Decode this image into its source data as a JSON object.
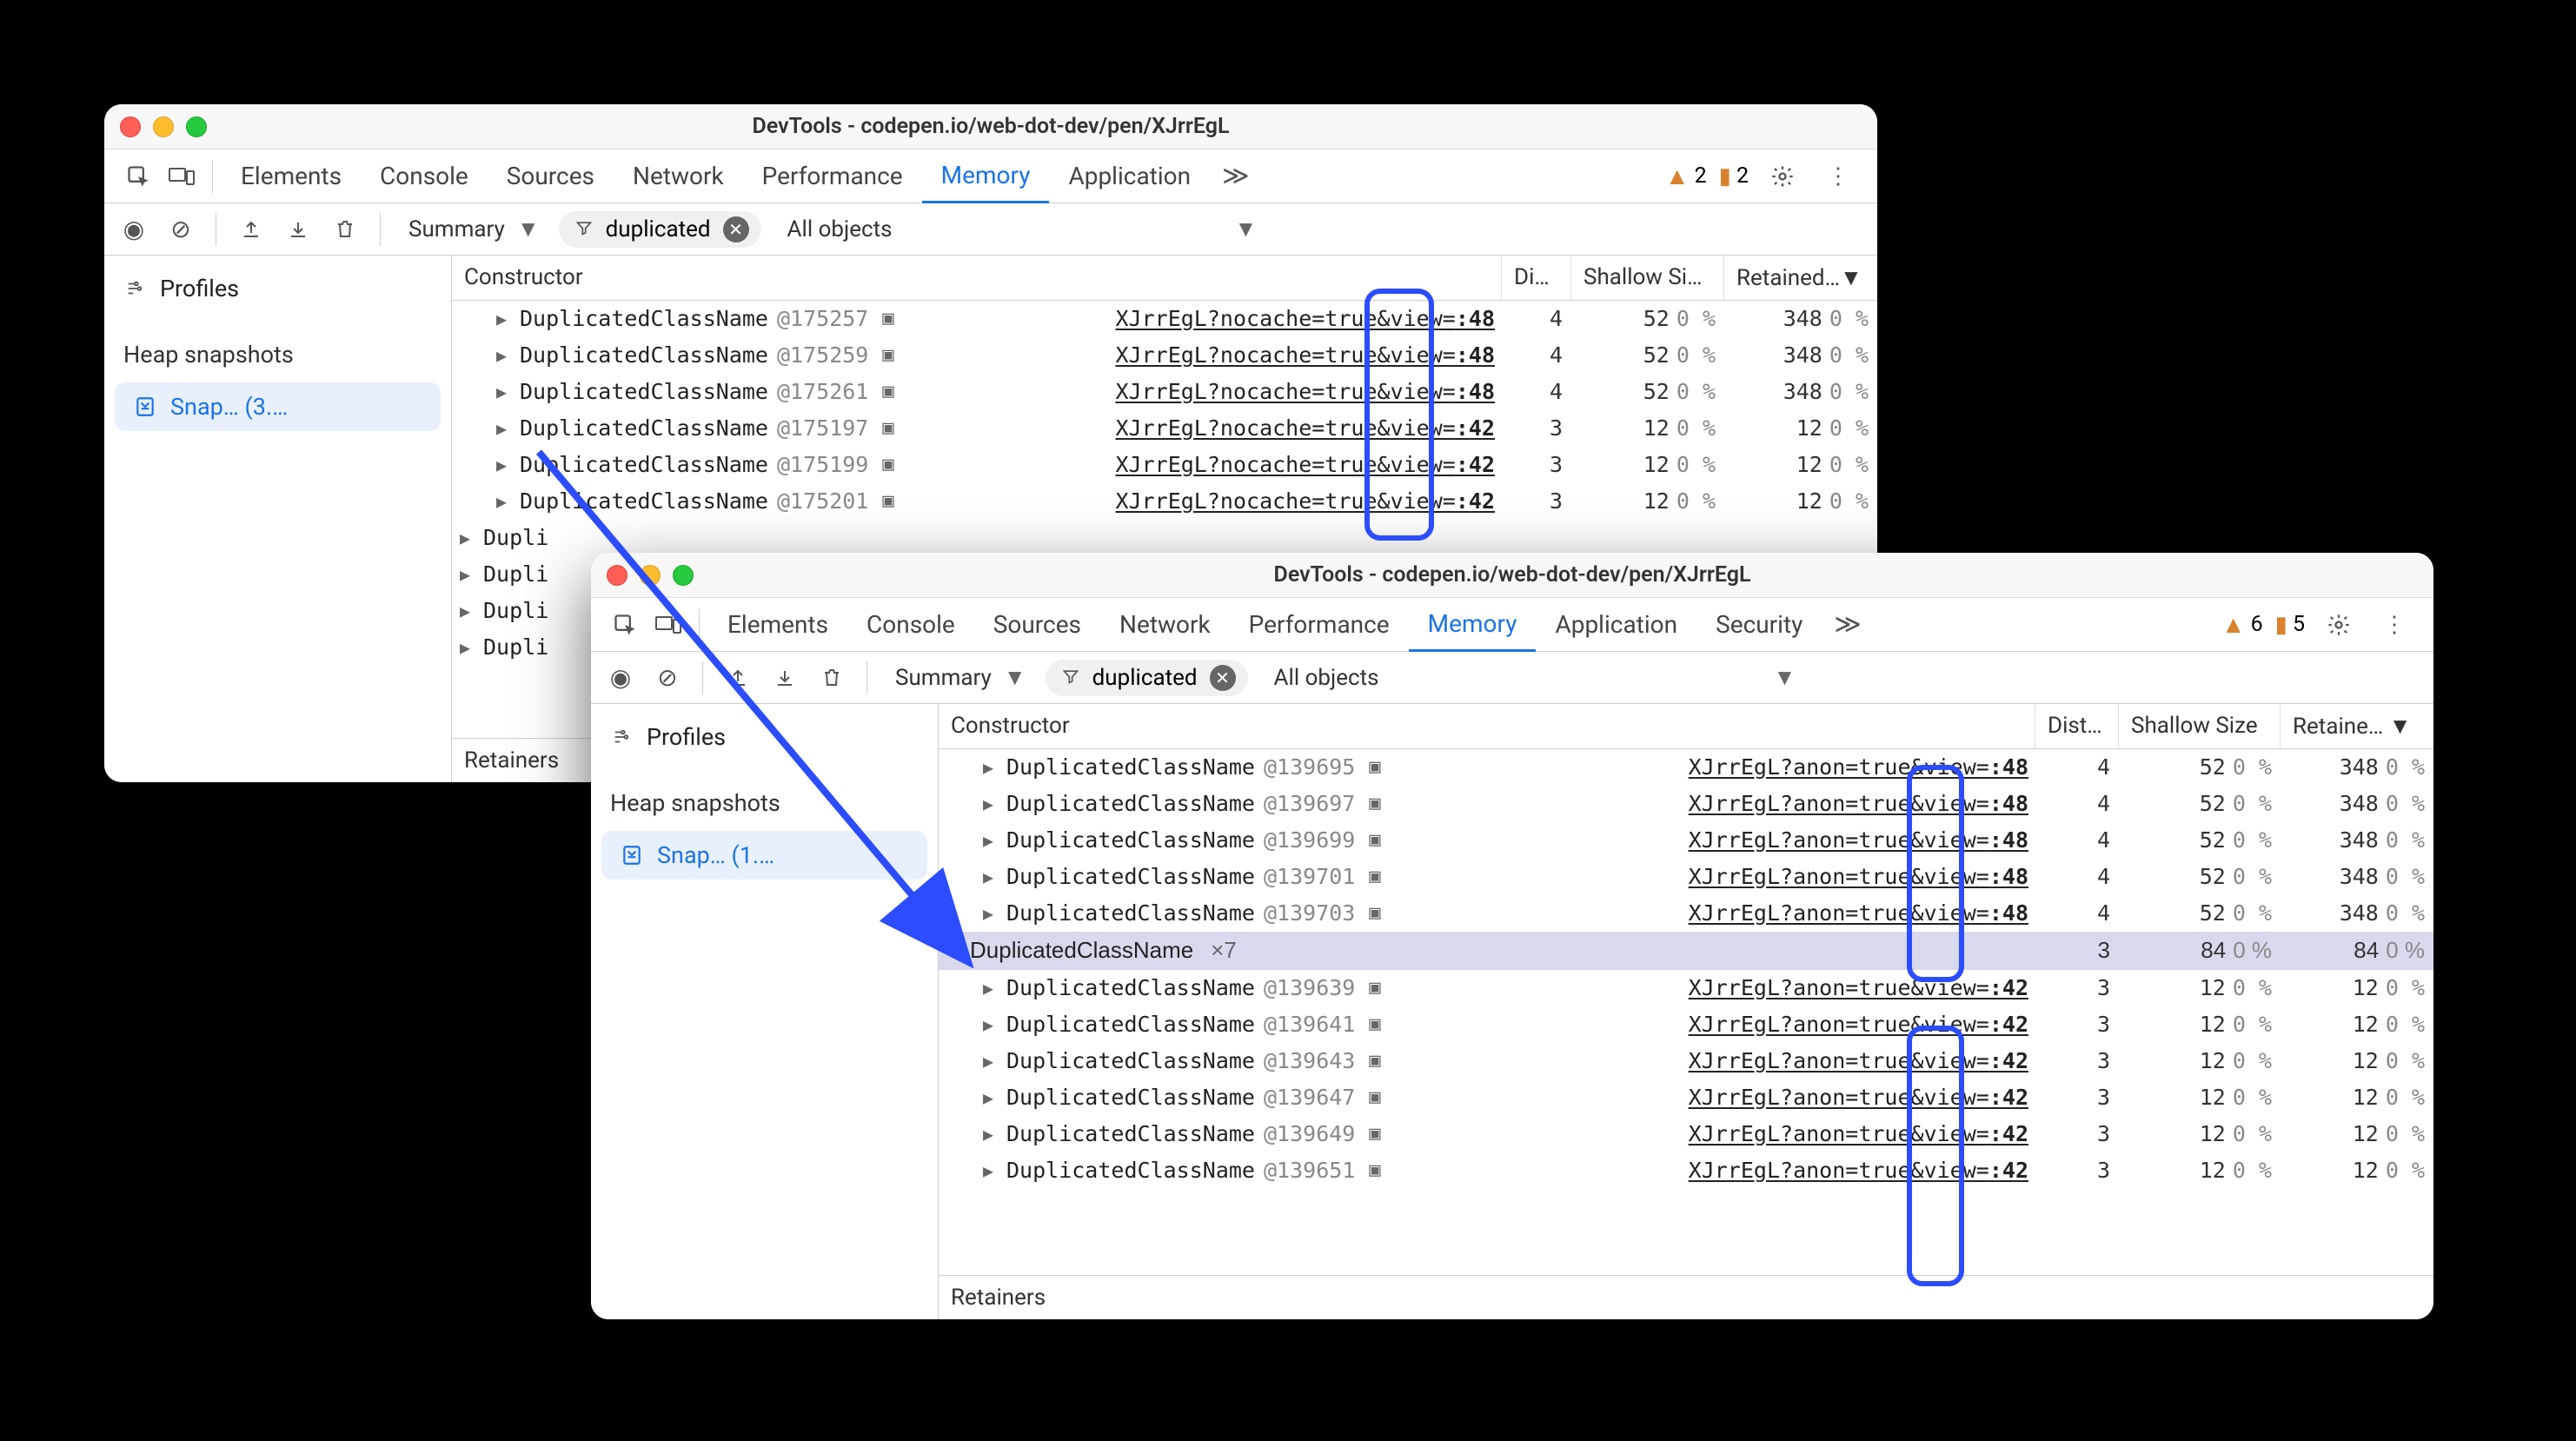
{
  "win1": {
    "title": "DevTools - codepen.io/web-dot-dev/pen/XJrrEgL",
    "tabs": [
      "Elements",
      "Console",
      "Sources",
      "Network",
      "Performance",
      "Memory",
      "Application"
    ],
    "active_tab": 5,
    "more": "≫",
    "warn_count": "2",
    "issue_count": "2",
    "toolbar": {
      "summary": "Summary",
      "filter_label": "duplicated",
      "scope": "All objects"
    },
    "sidebar": {
      "profiles": "Profiles",
      "heap": "Heap snapshots",
      "item": "Snap…  (3.…"
    },
    "headers": {
      "constructor": "Constructor",
      "dist": "Di…",
      "shallow": "Shallow Si…",
      "retained": "Retained…▼"
    },
    "rows": [
      {
        "id": "@175257",
        "src": "XJrrEgL?nocache=true&view=",
        "line": ":48",
        "dist": "4",
        "sh": "52",
        "shp": "0 %",
        "ret": "348",
        "retp": "0 %"
      },
      {
        "id": "@175259",
        "src": "XJrrEgL?nocache=true&view=",
        "line": ":48",
        "dist": "4",
        "sh": "52",
        "shp": "0 %",
        "ret": "348",
        "retp": "0 %"
      },
      {
        "id": "@175261",
        "src": "XJrrEgL?nocache=true&view=",
        "line": ":48",
        "dist": "4",
        "sh": "52",
        "shp": "0 %",
        "ret": "348",
        "retp": "0 %"
      },
      {
        "id": "@175197",
        "src": "XJrrEgL?nocache=true&view=",
        "line": ":42",
        "dist": "3",
        "sh": "12",
        "shp": "0 %",
        "ret": "12",
        "retp": "0 %"
      },
      {
        "id": "@175199",
        "src": "XJrrEgL?nocache=true&view=",
        "line": ":42",
        "dist": "3",
        "sh": "12",
        "shp": "0 %",
        "ret": "12",
        "retp": "0 %"
      },
      {
        "id": "@175201",
        "src": "XJrrEgL?nocache=true&view=",
        "line": ":42",
        "dist": "3",
        "sh": "12",
        "shp": "0 %",
        "ret": "12",
        "retp": "0 %"
      }
    ],
    "trunc_rows": [
      "Dupli",
      "Dupli",
      "Dupli",
      "Dupli"
    ],
    "class_label": "DuplicatedClassName",
    "retainers": "Retainers"
  },
  "win2": {
    "title": "DevTools - codepen.io/web-dot-dev/pen/XJrrEgL",
    "tabs": [
      "Elements",
      "Console",
      "Sources",
      "Network",
      "Performance",
      "Memory",
      "Application",
      "Security"
    ],
    "active_tab": 5,
    "more": "≫",
    "warn_count": "6",
    "issue_count": "5",
    "toolbar": {
      "summary": "Summary",
      "filter_label": "duplicated",
      "scope": "All objects"
    },
    "sidebar": {
      "profiles": "Profiles",
      "heap": "Heap snapshots",
      "item": "Snap…  (1.…"
    },
    "headers": {
      "constructor": "Constructor",
      "dist": "Dist…",
      "shallow": "Shallow Size",
      "retained": "Retaine… ▼"
    },
    "rows_a": [
      {
        "id": "@139695",
        "src": "XJrrEgL?anon=true&view=",
        "line": ":48",
        "dist": "4",
        "sh": "52",
        "shp": "0 %",
        "ret": "348",
        "retp": "0 %"
      },
      {
        "id": "@139697",
        "src": "XJrrEgL?anon=true&view=",
        "line": ":48",
        "dist": "4",
        "sh": "52",
        "shp": "0 %",
        "ret": "348",
        "retp": "0 %"
      },
      {
        "id": "@139699",
        "src": "XJrrEgL?anon=true&view=",
        "line": ":48",
        "dist": "4",
        "sh": "52",
        "shp": "0 %",
        "ret": "348",
        "retp": "0 %"
      },
      {
        "id": "@139701",
        "src": "XJrrEgL?anon=true&view=",
        "line": ":48",
        "dist": "4",
        "sh": "52",
        "shp": "0 %",
        "ret": "348",
        "retp": "0 %"
      },
      {
        "id": "@139703",
        "src": "XJrrEgL?anon=true&view=",
        "line": ":48",
        "dist": "4",
        "sh": "52",
        "shp": "0 %",
        "ret": "348",
        "retp": "0 %"
      }
    ],
    "group_row": {
      "label": "DuplicatedClassName",
      "count": "×7",
      "dist": "3",
      "sh": "84",
      "shp": "0 %",
      "ret": "84",
      "retp": "0 %"
    },
    "rows_b": [
      {
        "id": "@139639",
        "src": "XJrrEgL?anon=true&view=",
        "line": ":42",
        "dist": "3",
        "sh": "12",
        "shp": "0 %",
        "ret": "12",
        "retp": "0 %"
      },
      {
        "id": "@139641",
        "src": "XJrrEgL?anon=true&view=",
        "line": ":42",
        "dist": "3",
        "sh": "12",
        "shp": "0 %",
        "ret": "12",
        "retp": "0 %"
      },
      {
        "id": "@139643",
        "src": "XJrrEgL?anon=true&view=",
        "line": ":42",
        "dist": "3",
        "sh": "12",
        "shp": "0 %",
        "ret": "12",
        "retp": "0 %"
      },
      {
        "id": "@139647",
        "src": "XJrrEgL?anon=true&view=",
        "line": ":42",
        "dist": "3",
        "sh": "12",
        "shp": "0 %",
        "ret": "12",
        "retp": "0 %"
      },
      {
        "id": "@139649",
        "src": "XJrrEgL?anon=true&view=",
        "line": ":42",
        "dist": "3",
        "sh": "12",
        "shp": "0 %",
        "ret": "12",
        "retp": "0 %"
      },
      {
        "id": "@139651",
        "src": "XJrrEgL?anon=true&view=",
        "line": ":42",
        "dist": "3",
        "sh": "12",
        "shp": "0 %",
        "ret": "12",
        "retp": "0 %"
      }
    ],
    "class_label": "DuplicatedClassName",
    "retainers": "Retainers"
  }
}
